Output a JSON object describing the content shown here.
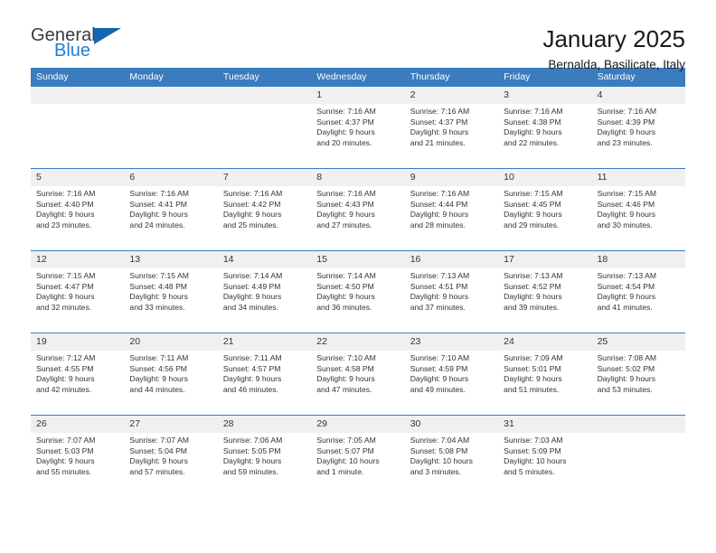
{
  "logo": {
    "word_general": "General",
    "word_blue": "Blue",
    "triangle_color": "#1565b0",
    "blue_color": "#1c7fd4"
  },
  "header": {
    "title": "January 2025",
    "subtitle": "Bernalda, Basilicate, Italy",
    "header_bg_color": "#3a7cbe",
    "daynum_bg_color": "#f0f0f0"
  },
  "weekdays": [
    "Sunday",
    "Monday",
    "Tuesday",
    "Wednesday",
    "Thursday",
    "Friday",
    "Saturday"
  ],
  "weeks": [
    {
      "numbers": [
        "",
        "",
        "",
        "1",
        "2",
        "3",
        "4"
      ],
      "cells": [
        {
          "sunrise": "",
          "sunset": "",
          "daylight1": "",
          "daylight2": ""
        },
        {
          "sunrise": "",
          "sunset": "",
          "daylight1": "",
          "daylight2": ""
        },
        {
          "sunrise": "",
          "sunset": "",
          "daylight1": "",
          "daylight2": ""
        },
        {
          "sunrise": "Sunrise: 7:16 AM",
          "sunset": "Sunset: 4:37 PM",
          "daylight1": "Daylight: 9 hours",
          "daylight2": "and 20 minutes."
        },
        {
          "sunrise": "Sunrise: 7:16 AM",
          "sunset": "Sunset: 4:37 PM",
          "daylight1": "Daylight: 9 hours",
          "daylight2": "and 21 minutes."
        },
        {
          "sunrise": "Sunrise: 7:16 AM",
          "sunset": "Sunset: 4:38 PM",
          "daylight1": "Daylight: 9 hours",
          "daylight2": "and 22 minutes."
        },
        {
          "sunrise": "Sunrise: 7:16 AM",
          "sunset": "Sunset: 4:39 PM",
          "daylight1": "Daylight: 9 hours",
          "daylight2": "and 23 minutes."
        }
      ]
    },
    {
      "numbers": [
        "5",
        "6",
        "7",
        "8",
        "9",
        "10",
        "11"
      ],
      "cells": [
        {
          "sunrise": "Sunrise: 7:16 AM",
          "sunset": "Sunset: 4:40 PM",
          "daylight1": "Daylight: 9 hours",
          "daylight2": "and 23 minutes."
        },
        {
          "sunrise": "Sunrise: 7:16 AM",
          "sunset": "Sunset: 4:41 PM",
          "daylight1": "Daylight: 9 hours",
          "daylight2": "and 24 minutes."
        },
        {
          "sunrise": "Sunrise: 7:16 AM",
          "sunset": "Sunset: 4:42 PM",
          "daylight1": "Daylight: 9 hours",
          "daylight2": "and 25 minutes."
        },
        {
          "sunrise": "Sunrise: 7:16 AM",
          "sunset": "Sunset: 4:43 PM",
          "daylight1": "Daylight: 9 hours",
          "daylight2": "and 27 minutes."
        },
        {
          "sunrise": "Sunrise: 7:16 AM",
          "sunset": "Sunset: 4:44 PM",
          "daylight1": "Daylight: 9 hours",
          "daylight2": "and 28 minutes."
        },
        {
          "sunrise": "Sunrise: 7:15 AM",
          "sunset": "Sunset: 4:45 PM",
          "daylight1": "Daylight: 9 hours",
          "daylight2": "and 29 minutes."
        },
        {
          "sunrise": "Sunrise: 7:15 AM",
          "sunset": "Sunset: 4:46 PM",
          "daylight1": "Daylight: 9 hours",
          "daylight2": "and 30 minutes."
        }
      ]
    },
    {
      "numbers": [
        "12",
        "13",
        "14",
        "15",
        "16",
        "17",
        "18"
      ],
      "cells": [
        {
          "sunrise": "Sunrise: 7:15 AM",
          "sunset": "Sunset: 4:47 PM",
          "daylight1": "Daylight: 9 hours",
          "daylight2": "and 32 minutes."
        },
        {
          "sunrise": "Sunrise: 7:15 AM",
          "sunset": "Sunset: 4:48 PM",
          "daylight1": "Daylight: 9 hours",
          "daylight2": "and 33 minutes."
        },
        {
          "sunrise": "Sunrise: 7:14 AM",
          "sunset": "Sunset: 4:49 PM",
          "daylight1": "Daylight: 9 hours",
          "daylight2": "and 34 minutes."
        },
        {
          "sunrise": "Sunrise: 7:14 AM",
          "sunset": "Sunset: 4:50 PM",
          "daylight1": "Daylight: 9 hours",
          "daylight2": "and 36 minutes."
        },
        {
          "sunrise": "Sunrise: 7:13 AM",
          "sunset": "Sunset: 4:51 PM",
          "daylight1": "Daylight: 9 hours",
          "daylight2": "and 37 minutes."
        },
        {
          "sunrise": "Sunrise: 7:13 AM",
          "sunset": "Sunset: 4:52 PM",
          "daylight1": "Daylight: 9 hours",
          "daylight2": "and 39 minutes."
        },
        {
          "sunrise": "Sunrise: 7:13 AM",
          "sunset": "Sunset: 4:54 PM",
          "daylight1": "Daylight: 9 hours",
          "daylight2": "and 41 minutes."
        }
      ]
    },
    {
      "numbers": [
        "19",
        "20",
        "21",
        "22",
        "23",
        "24",
        "25"
      ],
      "cells": [
        {
          "sunrise": "Sunrise: 7:12 AM",
          "sunset": "Sunset: 4:55 PM",
          "daylight1": "Daylight: 9 hours",
          "daylight2": "and 42 minutes."
        },
        {
          "sunrise": "Sunrise: 7:11 AM",
          "sunset": "Sunset: 4:56 PM",
          "daylight1": "Daylight: 9 hours",
          "daylight2": "and 44 minutes."
        },
        {
          "sunrise": "Sunrise: 7:11 AM",
          "sunset": "Sunset: 4:57 PM",
          "daylight1": "Daylight: 9 hours",
          "daylight2": "and 46 minutes."
        },
        {
          "sunrise": "Sunrise: 7:10 AM",
          "sunset": "Sunset: 4:58 PM",
          "daylight1": "Daylight: 9 hours",
          "daylight2": "and 47 minutes."
        },
        {
          "sunrise": "Sunrise: 7:10 AM",
          "sunset": "Sunset: 4:59 PM",
          "daylight1": "Daylight: 9 hours",
          "daylight2": "and 49 minutes."
        },
        {
          "sunrise": "Sunrise: 7:09 AM",
          "sunset": "Sunset: 5:01 PM",
          "daylight1": "Daylight: 9 hours",
          "daylight2": "and 51 minutes."
        },
        {
          "sunrise": "Sunrise: 7:08 AM",
          "sunset": "Sunset: 5:02 PM",
          "daylight1": "Daylight: 9 hours",
          "daylight2": "and 53 minutes."
        }
      ]
    },
    {
      "numbers": [
        "26",
        "27",
        "28",
        "29",
        "30",
        "31",
        ""
      ],
      "cells": [
        {
          "sunrise": "Sunrise: 7:07 AM",
          "sunset": "Sunset: 5:03 PM",
          "daylight1": "Daylight: 9 hours",
          "daylight2": "and 55 minutes."
        },
        {
          "sunrise": "Sunrise: 7:07 AM",
          "sunset": "Sunset: 5:04 PM",
          "daylight1": "Daylight: 9 hours",
          "daylight2": "and 57 minutes."
        },
        {
          "sunrise": "Sunrise: 7:06 AM",
          "sunset": "Sunset: 5:05 PM",
          "daylight1": "Daylight: 9 hours",
          "daylight2": "and 59 minutes."
        },
        {
          "sunrise": "Sunrise: 7:05 AM",
          "sunset": "Sunset: 5:07 PM",
          "daylight1": "Daylight: 10 hours",
          "daylight2": "and 1 minute."
        },
        {
          "sunrise": "Sunrise: 7:04 AM",
          "sunset": "Sunset: 5:08 PM",
          "daylight1": "Daylight: 10 hours",
          "daylight2": "and 3 minutes."
        },
        {
          "sunrise": "Sunrise: 7:03 AM",
          "sunset": "Sunset: 5:09 PM",
          "daylight1": "Daylight: 10 hours",
          "daylight2": "and 5 minutes."
        },
        {
          "sunrise": "",
          "sunset": "",
          "daylight1": "",
          "daylight2": ""
        }
      ]
    }
  ]
}
